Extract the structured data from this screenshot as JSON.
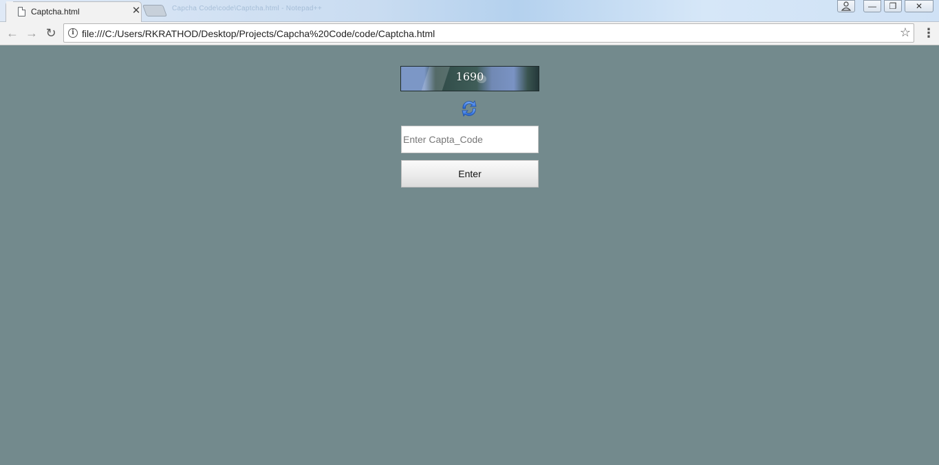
{
  "browser": {
    "tab": {
      "title": "Captcha.html",
      "close_glyph": "✕"
    },
    "background_tab_title": "Capcha Code\\code\\Captcha.html - Notepad++",
    "address": {
      "url": "file:///C:/Users/RKRATHOD/Desktop/Projects/Capcha%20Code/code/Captcha.html"
    },
    "nav": {
      "back": "←",
      "forward": "→",
      "reload": "↻"
    },
    "window_controls": {
      "minimize": "—",
      "maximize": "❐",
      "close": "✕"
    }
  },
  "page": {
    "background_color": "#738a8d",
    "captcha": {
      "code": "1690"
    },
    "refresh_icon": "refresh-arrows-icon",
    "input": {
      "placeholder": "Enter Capta_Code",
      "value": ""
    },
    "submit_label": "Enter"
  }
}
